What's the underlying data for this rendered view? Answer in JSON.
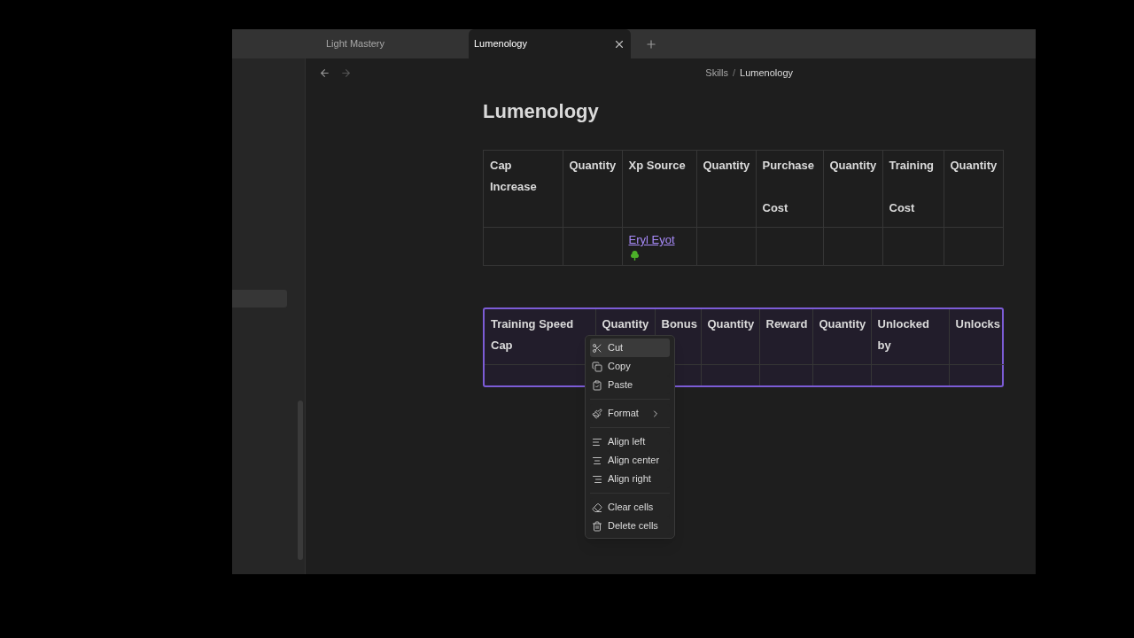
{
  "tabs": [
    {
      "label": "Light Mastery",
      "selected": false
    },
    {
      "label": "Lumenology",
      "selected": true
    }
  ],
  "nav": {
    "forward_disabled": true
  },
  "breadcrumb": {
    "items": [
      "Skills",
      "Lumenology"
    ],
    "separator": "/"
  },
  "title": "Lumenology",
  "tables": [
    {
      "selected": false,
      "columns": [
        "Cap Increase",
        "Quantity",
        "Xp Source",
        "Quantity",
        "Purchase\n\nCost",
        "Quantity",
        "Training\n\nCost",
        "Quantity"
      ],
      "rows": [
        [
          null,
          null,
          {
            "kind": "link",
            "text": "Eryl Eyot "
          },
          null,
          null,
          null,
          null,
          null
        ]
      ]
    },
    {
      "selected": true,
      "columns": [
        "Training Speed Cap",
        "Quantity",
        "Bonus",
        "Quantity",
        "Reward",
        "Quantity",
        "Unlocked by",
        "Unlocks"
      ],
      "rows": [
        [
          null,
          null,
          null,
          null,
          null,
          null,
          null,
          null
        ]
      ]
    }
  ],
  "context_menu": {
    "groups": [
      [
        {
          "label": "Cut",
          "highlighted": true,
          "submenu": false
        },
        {
          "label": "Copy",
          "highlighted": false,
          "submenu": false
        },
        {
          "label": "Paste",
          "highlighted": false,
          "submenu": false
        }
      ],
      [
        {
          "label": "Format",
          "highlighted": false,
          "submenu": true
        }
      ],
      [
        {
          "label": "Align left",
          "highlighted": false,
          "submenu": false
        },
        {
          "label": "Align center",
          "highlighted": false,
          "submenu": false
        },
        {
          "label": "Align right",
          "highlighted": false,
          "submenu": false
        }
      ],
      [
        {
          "label": "Clear cells",
          "highlighted": false,
          "submenu": false
        },
        {
          "label": "Delete cells",
          "highlighted": false,
          "submenu": false
        }
      ]
    ]
  }
}
